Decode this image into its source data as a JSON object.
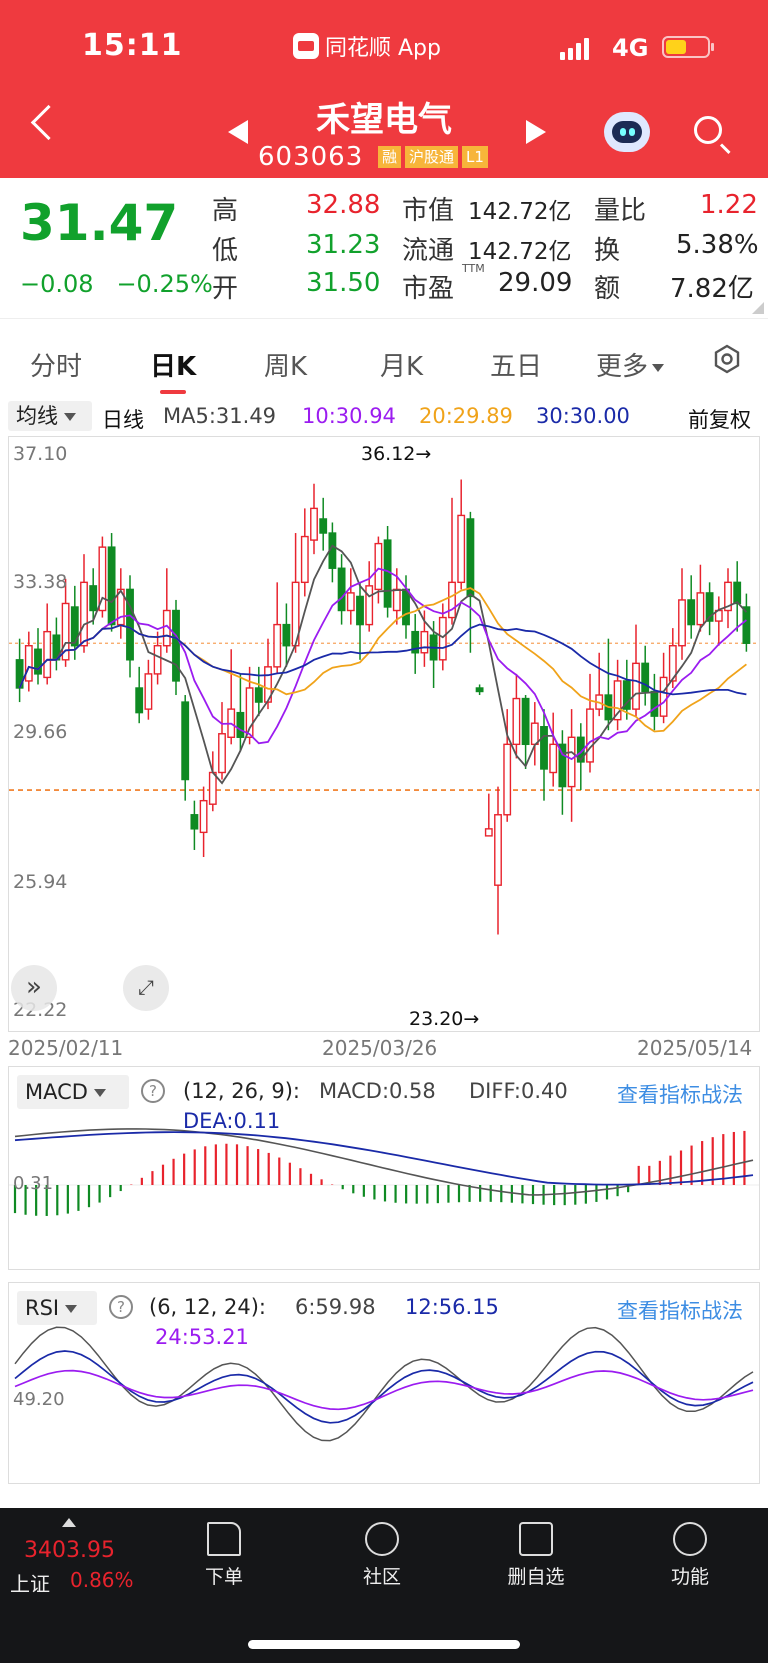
{
  "status_bar": {
    "time": "15:11",
    "app_name": "同花顺 App",
    "network": "4G"
  },
  "header": {
    "stock_name": "禾望电气",
    "stock_code": "603063",
    "tags": [
      "融",
      "沪股通",
      "L1"
    ]
  },
  "quote": {
    "price": "31.47",
    "change": "−0.08",
    "change_pct": "−0.25%",
    "items": [
      {
        "label": "高",
        "value": "32.88"
      },
      {
        "label": "低",
        "value": "31.23"
      },
      {
        "label": "开",
        "value": "31.50"
      }
    ],
    "market_cap_label": "市值",
    "market_cap": "142.72亿",
    "float_label": "流通",
    "float_cap": "142.72亿",
    "pe_label": "市盈",
    "pe_sup": "TTM",
    "pe": "29.09",
    "vol_ratio_label": "量比",
    "vol_ratio": "1.22",
    "turnover_label": "换",
    "turnover": "5.38%",
    "amount_label": "额",
    "amount": "7.82亿"
  },
  "tabs": [
    "分时",
    "日K",
    "周K",
    "月K",
    "五日",
    "更多"
  ],
  "active_tab": "日K",
  "indicator_bar": {
    "selector": "均线",
    "period": "日线",
    "ma5": "MA5:31.49",
    "ma10": "10:30.94",
    "ma20": "20:29.89",
    "ma30": "30:30.00",
    "adjust": "前复权"
  },
  "colors": {
    "red": "#e8232d",
    "green": "#0f8a23",
    "ma5": "#555555",
    "ma10": "#9b1cf0",
    "ma20": "#f0a31a",
    "ma30": "#1a2aa8",
    "accent": "#ef3a3f",
    "link": "#3d8de3"
  },
  "main_chart": {
    "y_labels": [
      "37.10",
      "33.38",
      "29.66",
      "25.94",
      "22.22"
    ],
    "high_label": "36.12→",
    "low_label": "23.20→",
    "dates": [
      "2025/02/11",
      "2025/03/26",
      "2025/05/14"
    ]
  },
  "macd": {
    "selector": "MACD",
    "params": "(12, 26, 9):",
    "macd": "MACD:0.58",
    "diff": "DIFF:0.40",
    "dea": "DEA:0.11",
    "y_label": "0.31",
    "link": "查看指标战法"
  },
  "rsi": {
    "selector": "RSI",
    "params": "(6, 12, 24):",
    "rsi6": "6:59.98",
    "rsi12": "12:56.15",
    "rsi24": "24:53.21",
    "y_label": "49.20",
    "link": "查看指标战法"
  },
  "bottom": {
    "index_value": "3403.95",
    "index_name": "上证",
    "index_pct": "0.86%",
    "nav": [
      "下单",
      "社区",
      "删自选",
      "功能"
    ]
  },
  "chart_data": {
    "type": "candlestick",
    "ylim": [
      22.22,
      37.1
    ],
    "candles": [
      [
        31.0,
        30.2,
        31.6,
        29.8
      ],
      [
        30.4,
        31.4,
        31.8,
        30.1
      ],
      [
        31.3,
        30.6,
        31.9,
        30.3
      ],
      [
        30.5,
        31.8,
        32.6,
        30.3
      ],
      [
        31.7,
        31.0,
        32.2,
        30.7
      ],
      [
        31.0,
        32.6,
        33.3,
        30.8
      ],
      [
        32.5,
        31.4,
        33.1,
        31.0
      ],
      [
        31.4,
        33.2,
        34.0,
        31.2
      ],
      [
        33.1,
        32.4,
        33.6,
        32.0
      ],
      [
        32.4,
        34.2,
        34.5,
        32.2
      ],
      [
        34.2,
        32.0,
        34.6,
        31.8
      ],
      [
        32.0,
        33.0,
        33.6,
        31.6
      ],
      [
        33.0,
        31.0,
        33.4,
        30.5
      ],
      [
        30.2,
        29.5,
        30.8,
        29.2
      ],
      [
        29.6,
        30.6,
        31.0,
        29.3
      ],
      [
        30.6,
        31.4,
        31.8,
        30.3
      ],
      [
        31.4,
        32.4,
        33.6,
        31.2
      ],
      [
        32.4,
        30.4,
        32.7,
        30.0
      ],
      [
        29.8,
        27.6,
        30.0,
        27.0
      ],
      [
        26.6,
        26.2,
        27.0,
        25.6
      ],
      [
        26.1,
        27.0,
        27.4,
        25.4
      ],
      [
        26.9,
        27.8,
        28.4,
        26.7
      ],
      [
        27.8,
        28.9,
        29.8,
        27.6
      ],
      [
        28.8,
        29.6,
        31.3,
        28.6
      ],
      [
        29.5,
        28.8,
        30.6,
        28.4
      ],
      [
        28.8,
        30.2,
        30.8,
        28.6
      ],
      [
        30.2,
        29.8,
        30.8,
        29.4
      ],
      [
        29.8,
        30.8,
        31.6,
        29.6
      ],
      [
        30.8,
        32.0,
        33.2,
        30.6
      ],
      [
        32.0,
        31.4,
        32.6,
        30.8
      ],
      [
        31.4,
        33.2,
        34.6,
        31.2
      ],
      [
        33.2,
        34.5,
        35.3,
        32.8
      ],
      [
        34.4,
        35.3,
        36.0,
        34.0
      ],
      [
        35.0,
        34.6,
        35.6,
        34.1
      ],
      [
        34.6,
        33.6,
        34.9,
        33.2
      ],
      [
        33.6,
        32.4,
        34.0,
        32.0
      ],
      [
        32.4,
        32.9,
        33.6,
        32.0
      ],
      [
        32.8,
        32.0,
        33.2,
        31.0
      ],
      [
        32.0,
        33.1,
        33.8,
        31.8
      ],
      [
        33.0,
        34.3,
        34.5,
        32.6
      ],
      [
        34.4,
        32.5,
        34.8,
        32.2
      ],
      [
        32.4,
        33.0,
        33.6,
        32.0
      ],
      [
        33.0,
        32.0,
        33.4,
        31.6
      ],
      [
        31.8,
        31.2,
        32.3,
        30.6
      ],
      [
        31.2,
        31.8,
        32.4,
        30.8
      ],
      [
        31.7,
        31.0,
        32.1,
        30.2
      ],
      [
        31.0,
        32.2,
        32.6,
        30.7
      ],
      [
        32.2,
        33.2,
        35.6,
        32.0
      ],
      [
        33.2,
        35.1,
        36.12,
        33.0
      ],
      [
        35.0,
        32.8,
        35.2,
        31.2
      ],
      [
        30.2,
        30.1,
        30.3,
        30.0
      ],
      [
        26.0,
        26.2,
        27.2,
        26.0
      ],
      [
        24.6,
        26.6,
        27.4,
        23.2
      ],
      [
        26.6,
        28.6,
        29.6,
        26.4
      ],
      [
        28.6,
        29.9,
        30.6,
        28.2
      ],
      [
        29.9,
        28.6,
        30.0,
        27.9
      ],
      [
        28.6,
        29.2,
        29.8,
        28.0
      ],
      [
        29.1,
        27.9,
        29.6,
        27.0
      ],
      [
        27.8,
        28.6,
        29.5,
        27.4
      ],
      [
        28.6,
        27.4,
        29.0,
        26.6
      ],
      [
        27.4,
        28.8,
        29.6,
        26.4
      ],
      [
        28.8,
        28.1,
        29.2,
        27.3
      ],
      [
        28.1,
        29.6,
        30.6,
        27.8
      ],
      [
        29.6,
        30.0,
        31.2,
        29.4
      ],
      [
        30.0,
        29.3,
        31.6,
        29.0
      ],
      [
        29.3,
        30.4,
        31.0,
        29.0
      ],
      [
        30.4,
        29.6,
        31.0,
        29.3
      ],
      [
        29.6,
        30.9,
        32.0,
        29.4
      ],
      [
        30.9,
        30.1,
        31.4,
        29.7
      ],
      [
        30.1,
        29.4,
        30.6,
        29.0
      ],
      [
        29.4,
        30.5,
        31.2,
        29.2
      ],
      [
        30.4,
        31.4,
        31.9,
        30.2
      ],
      [
        31.4,
        32.7,
        33.6,
        31.0
      ],
      [
        32.7,
        32.0,
        33.4,
        31.6
      ],
      [
        32.0,
        32.9,
        33.7,
        31.8
      ],
      [
        32.9,
        32.1,
        33.2,
        31.7
      ],
      [
        32.1,
        32.4,
        32.8,
        31.4
      ],
      [
        32.4,
        33.2,
        33.6,
        31.9
      ],
      [
        33.2,
        32.6,
        33.8,
        31.8
      ],
      [
        32.5,
        31.47,
        32.88,
        31.23
      ]
    ]
  }
}
